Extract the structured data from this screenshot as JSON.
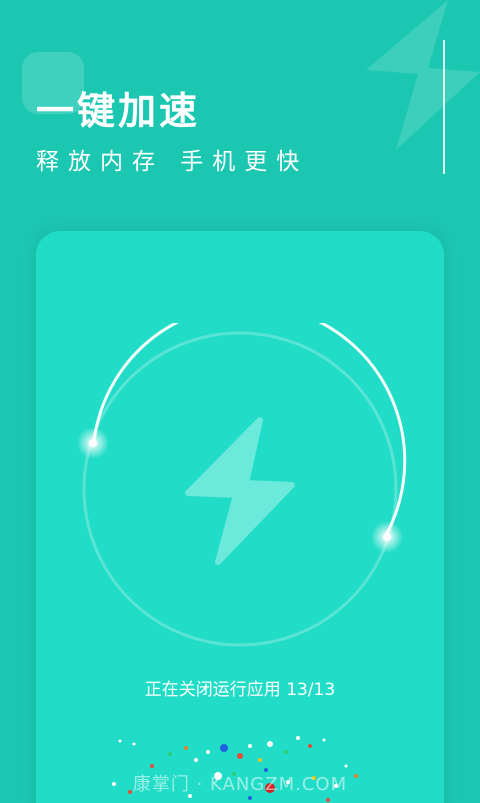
{
  "header": {
    "title": "一键加速",
    "subtitle": "释放内存  手机更快"
  },
  "boost": {
    "status_text": "正在关闭运行应用 13/13",
    "progress_current": 13,
    "progress_total": 13
  },
  "watermark": "康掌门 · KANGZM.COM",
  "colors": {
    "background": "#1cc7b2",
    "card": "#21dcc7",
    "bolt": "#6be9da",
    "ring": "#ffffff"
  },
  "icons": [
    "lightning-bolt-icon"
  ]
}
